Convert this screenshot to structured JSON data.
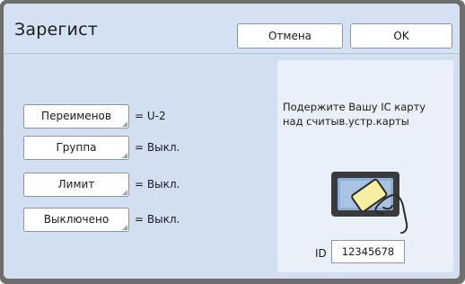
{
  "header": {
    "title": "Зарегист",
    "cancel_label": "Отмена",
    "ok_label": "OK"
  },
  "settings": [
    {
      "label": "Переименов",
      "value": "= U-2"
    },
    {
      "label": "Группа",
      "value": "= Выкл."
    },
    {
      "label": "Лимит",
      "value": "= Выкл."
    },
    {
      "label": "Выключено",
      "value": "= Выкл."
    }
  ],
  "card_panel": {
    "instruction_line1": "Подержите Вашу IC карту",
    "instruction_line2": "над считыв.устр.карты",
    "reader_icon": "ic-card-reader-icon",
    "id_label": "ID",
    "id_value": "12345678"
  },
  "colors": {
    "screen_bg": "#d1dff1",
    "panel_bg": "#eaf0f9",
    "card_yellow": "#f7eea0",
    "frame": "#6e6e6e"
  }
}
